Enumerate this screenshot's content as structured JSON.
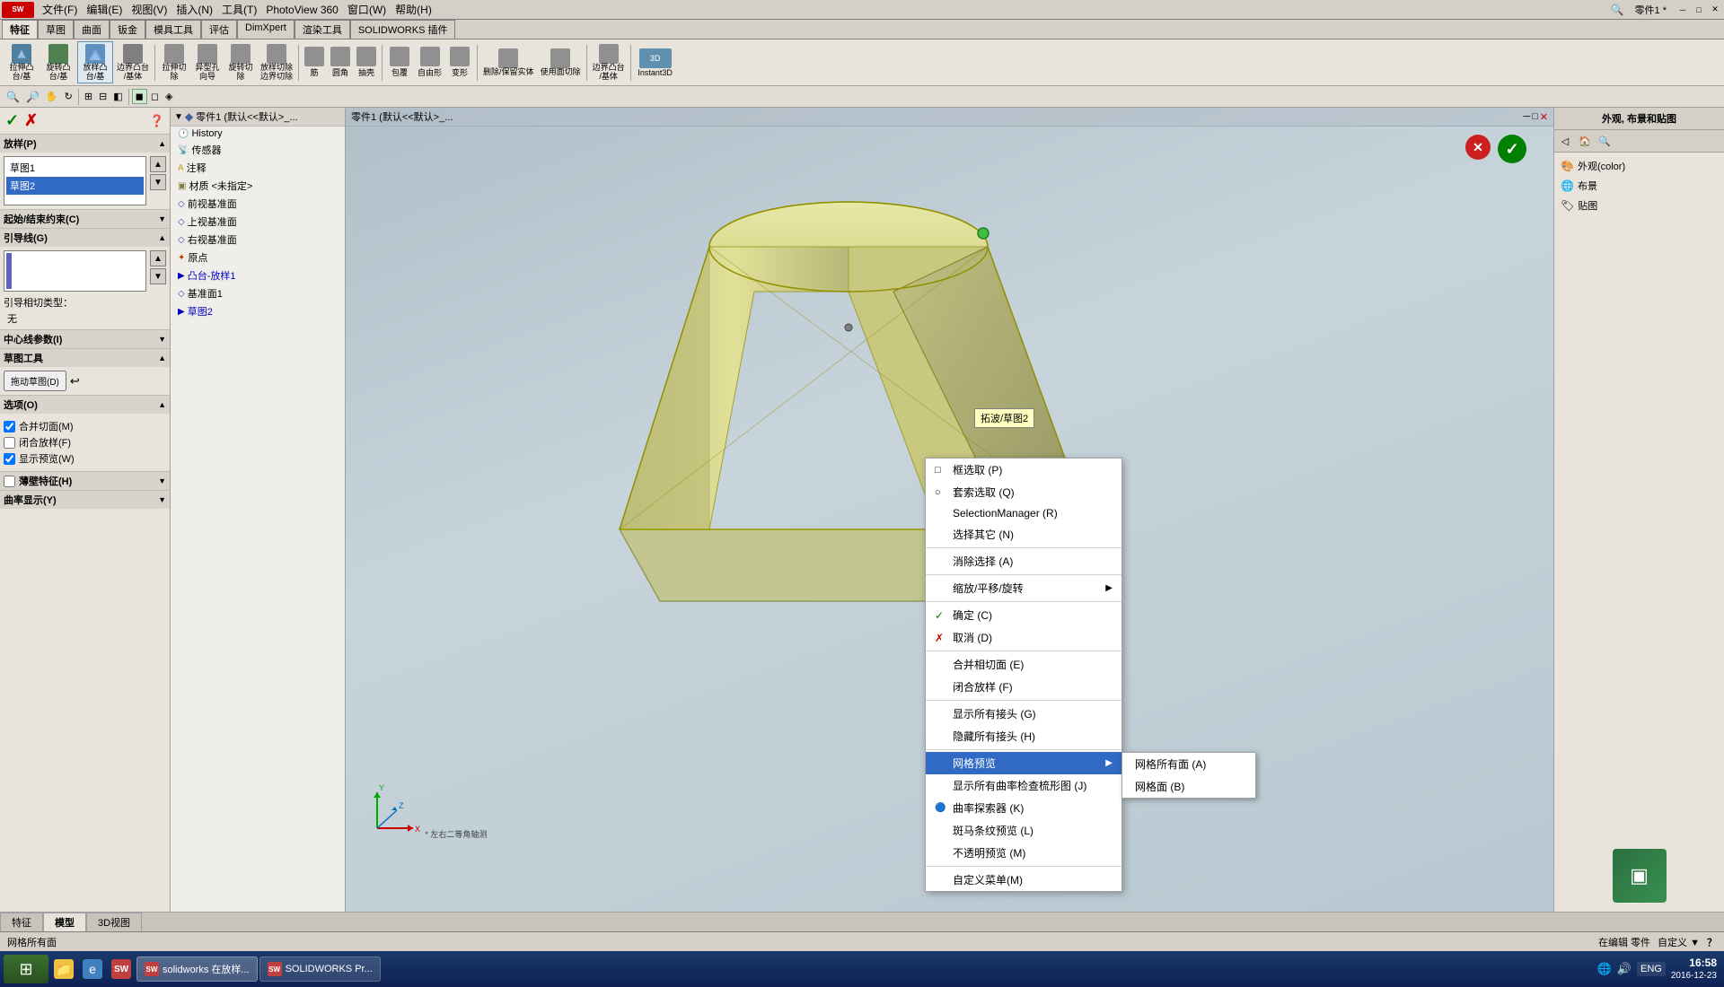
{
  "title": "零件1 *",
  "app_name": "SOLIDWORKS",
  "menu": {
    "items": [
      "文件(F)",
      "编辑(E)",
      "视图(V)",
      "插入(N)",
      "工具(T)",
      "PhotoView 360",
      "窗口(W)",
      "帮助(H)"
    ]
  },
  "toolbar_tabs": [
    "特征",
    "草图",
    "曲面",
    "钣金",
    "模具工具",
    "评估",
    "DimXpert",
    "渲染工具",
    "SOLIDWORKS 插件"
  ],
  "active_tab": "特征",
  "left_panel": {
    "confirm": {
      "check_label": "✓",
      "x_label": "✗"
    },
    "loft_section": {
      "title": "放样(P)",
      "profiles": [
        "草图1",
        "草图2"
      ],
      "selected": "草图2"
    },
    "start_end_constraint": {
      "title": "起始/结束约束(C)"
    },
    "guide_section": {
      "title": "引导线(G)",
      "type_label": "引导相切类型：",
      "type_value": "无"
    },
    "centerline_section": {
      "title": "中心线参数(I)"
    },
    "sketch_tools_section": {
      "title": "草图工具",
      "drag_sketch_label": "拖动草图(D)"
    },
    "options_section": {
      "title": "选项(O)",
      "merge_faces": "合并切面(M)",
      "close_loft": "闭合放样(F)",
      "show_preview": "显示预览(W)",
      "thin_feature": "薄壁特征(H)",
      "curvature_display": "曲率显示(Y)"
    }
  },
  "feature_tree": {
    "part_name": "零件1 (默认<<默认>_...",
    "items": [
      {
        "label": "History",
        "indent": 1,
        "icon": "clock"
      },
      {
        "label": "传感器",
        "indent": 1,
        "icon": "sensor"
      },
      {
        "label": "注释",
        "indent": 1,
        "icon": "annotation"
      },
      {
        "label": "材质 <未指定>",
        "indent": 1,
        "icon": "material"
      },
      {
        "label": "前视基准面",
        "indent": 1,
        "icon": "plane"
      },
      {
        "label": "上视基准面",
        "indent": 1,
        "icon": "plane"
      },
      {
        "label": "右视基准面",
        "indent": 1,
        "icon": "plane"
      },
      {
        "label": "原点",
        "indent": 1,
        "icon": "origin"
      },
      {
        "label": "凸台-放样1",
        "indent": 1,
        "icon": "feature",
        "editing": true
      },
      {
        "label": "基准面1",
        "indent": 1,
        "icon": "plane"
      },
      {
        "label": "草图2",
        "indent": 1,
        "icon": "sketch",
        "editing": true
      }
    ]
  },
  "context_menu": {
    "items": [
      {
        "label": "框选取 (P)",
        "icon": "□",
        "shortcut": "",
        "type": "item"
      },
      {
        "label": "套索选取 (Q)",
        "icon": "○",
        "shortcut": "",
        "type": "item"
      },
      {
        "label": "SelectionManager (R)",
        "icon": "",
        "shortcut": "",
        "type": "item"
      },
      {
        "label": "选择其它 (N)",
        "icon": "",
        "shortcut": "",
        "type": "item"
      },
      {
        "type": "separator"
      },
      {
        "label": "消除选择 (A)",
        "icon": "",
        "shortcut": "",
        "type": "item"
      },
      {
        "type": "separator"
      },
      {
        "label": "缩放/平移/旋转",
        "icon": "",
        "shortcut": "",
        "type": "item",
        "has_submenu": true
      },
      {
        "type": "separator"
      },
      {
        "label": "确定 (C)",
        "icon": "✓",
        "shortcut": "",
        "type": "item",
        "icon_color": "green"
      },
      {
        "label": "取消 (D)",
        "icon": "✗",
        "shortcut": "",
        "type": "item",
        "icon_color": "red"
      },
      {
        "type": "separator"
      },
      {
        "label": "合并相切面 (E)",
        "icon": "",
        "shortcut": "",
        "type": "item"
      },
      {
        "label": "闭合放样 (F)",
        "icon": "",
        "shortcut": "",
        "type": "item"
      },
      {
        "type": "separator"
      },
      {
        "label": "显示所有接头 (G)",
        "icon": "",
        "shortcut": "",
        "type": "item"
      },
      {
        "label": "隐藏所有接头 (H)",
        "icon": "",
        "shortcut": "",
        "type": "item"
      },
      {
        "type": "separator"
      },
      {
        "label": "网格预览",
        "icon": "",
        "shortcut": "",
        "type": "item",
        "has_submenu": true,
        "active_submenu": true
      },
      {
        "label": "显示所有曲率检查梳形图 (J)",
        "icon": "",
        "shortcut": "",
        "type": "item"
      },
      {
        "label": "曲率探索器 (K)",
        "icon": "",
        "shortcut": "",
        "type": "item"
      },
      {
        "label": "斑马条纹预览 (L)",
        "icon": "",
        "shortcut": "",
        "type": "item"
      },
      {
        "label": "不透明预览 (M)",
        "icon": "",
        "shortcut": "",
        "type": "item"
      },
      {
        "type": "separator"
      },
      {
        "label": "自定义菜单(M)",
        "icon": "",
        "shortcut": "",
        "type": "item"
      }
    ],
    "submenu_items": [
      {
        "label": "网格所有面 (A)",
        "type": "item"
      },
      {
        "label": "网格面 (B)",
        "type": "item"
      }
    ]
  },
  "right_panel": {
    "title": "外观, 布景和贴图",
    "tree_items": [
      {
        "label": "外观(color)",
        "icon": "appearance"
      },
      {
        "label": "布景",
        "icon": "scene"
      },
      {
        "label": "贴图",
        "icon": "decal"
      }
    ]
  },
  "viewport": {
    "title": "零件1 (默认<<默认>_...",
    "tooltip": "拓波/草图2"
  },
  "bottom_tabs": [
    "特征",
    "模型",
    "3D视图"
  ],
  "active_bottom_tab": "模型",
  "status_bar": {
    "left": "网格所有面",
    "right": "在编辑 零件",
    "zoom": "自定义 ▼",
    "help": "？"
  },
  "taskbar": {
    "time": "16:58",
    "date": "2016-12-23",
    "items": [
      {
        "label": "solidworks 在放样...",
        "icon": "sw"
      },
      {
        "label": "SOLIDWORKS Pr...",
        "icon": "sw2"
      }
    ]
  }
}
